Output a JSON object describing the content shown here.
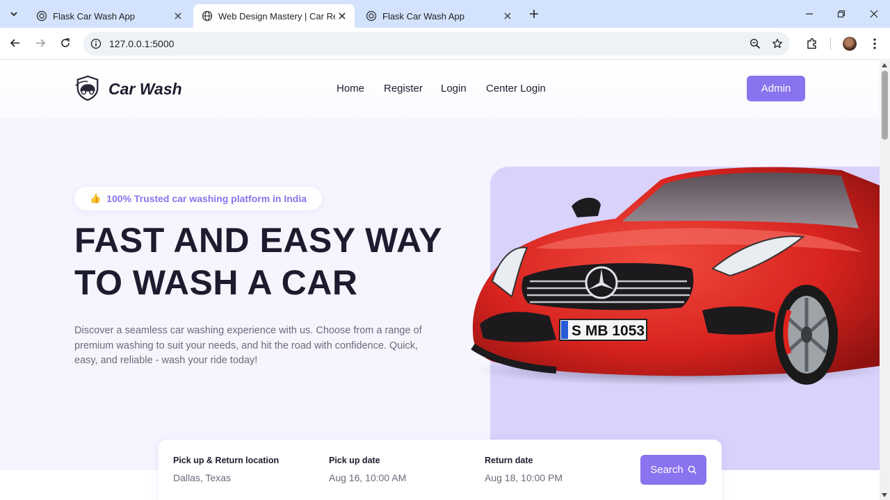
{
  "browser": {
    "tabs": [
      {
        "title": "Flask Car Wash App",
        "active": false
      },
      {
        "title": "Web Design Mastery | Car Rent",
        "active": true
      },
      {
        "title": "Flask Car Wash App",
        "active": false
      }
    ],
    "url": "127.0.0.1:5000"
  },
  "site": {
    "brand": "Car Wash",
    "nav": [
      "Home",
      "Register",
      "Login",
      "Center Login"
    ],
    "admin_label": "Admin"
  },
  "hero": {
    "badge": "100% Trusted car washing platform in India",
    "headline_line1": "FAST AND EASY WAY",
    "headline_line2": "TO WASH A CAR",
    "description": "Discover a seamless car washing experience with us. Choose from a range of premium washing to suit your needs, and hit the road with confidence. Quick, easy, and reliable - wash your ride today!",
    "plate": "S MB 1053"
  },
  "search": {
    "fields": [
      {
        "label": "Pick up & Return location",
        "value": "Dallas, Texas"
      },
      {
        "label": "Pick up date",
        "value": "Aug 16, 10:00 AM"
      },
      {
        "label": "Return date",
        "value": "Aug 18, 10:00 PM"
      }
    ],
    "button_label": "Search"
  },
  "colors": {
    "accent": "#8a73ee",
    "hero_panel": "#d9d2fb",
    "car": "#d8231f",
    "chrome_bg": "#d3e3fd"
  }
}
